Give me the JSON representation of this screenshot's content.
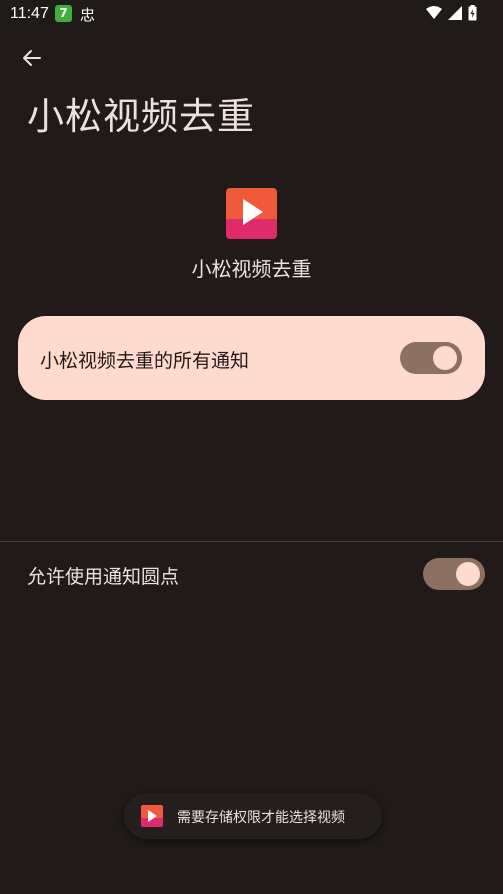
{
  "status_bar": {
    "time": "11:47",
    "app_badge_1": "7",
    "app_badge_2": "忠",
    "icons": [
      "wifi-icon",
      "signal-icon",
      "battery-icon"
    ]
  },
  "header": {
    "back_icon": "arrow-left-icon",
    "title": "小松视频去重"
  },
  "app": {
    "icon": "play-icon",
    "name": "小松视频去重"
  },
  "main_toggle": {
    "label": "小松视频去重的所有通知",
    "enabled": true
  },
  "settings": [
    {
      "label": "允许使用通知圆点",
      "enabled": true
    }
  ],
  "toast": {
    "icon": "play-icon",
    "text": "需要存储权限才能选择视频"
  },
  "colors": {
    "background": "#201a19",
    "card": "#ffdbcf",
    "switch_track": "#8c7163",
    "icon_top": "#f05a3a",
    "icon_bottom": "#e02b6a"
  }
}
